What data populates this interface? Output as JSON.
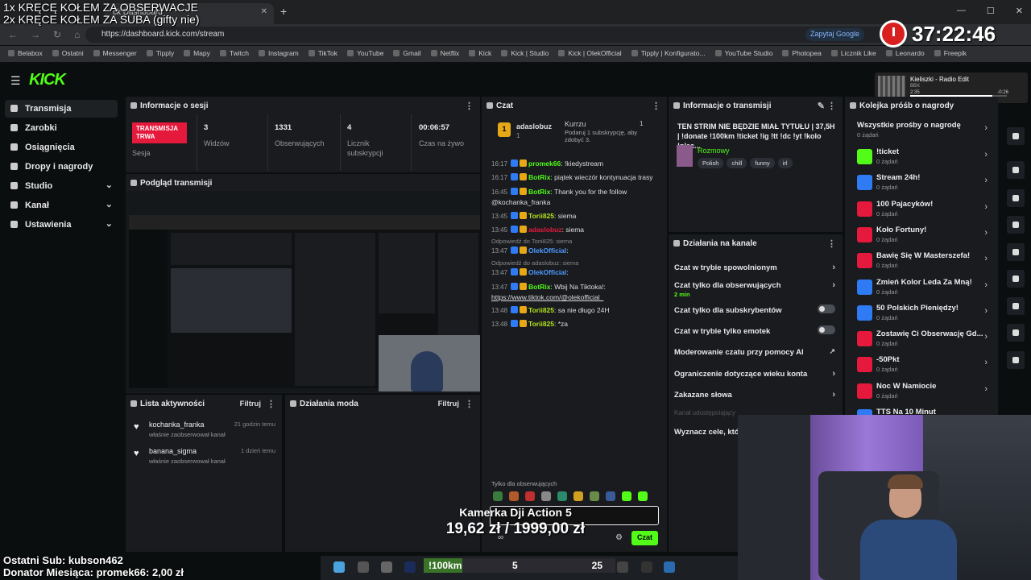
{
  "overlay": {
    "line1": "1x KRĘCĘ KOŁEM ZA OBSERWACJE",
    "line2": "2x KRĘCE KOŁEM ZA SUBA (gifty nie)",
    "timer": "37:22:46",
    "last_sub": "Ostatni Sub: kubson462",
    "donator": "Donator Miesiąca: promek66: 2,00 zł",
    "product_name": "Kamerka Dji Action 5",
    "product_price": "19,62 zł / 1999,00 zł"
  },
  "browser": {
    "tab_title": "ck Dashboard",
    "url": "https://dashboard.kick.com/stream",
    "ask_google": "Zapytaj Google",
    "bookmarks": [
      "Belabox",
      "Ostatni",
      "Messenger",
      "Tipply",
      "Mapy",
      "Twitch",
      "Instagram",
      "TikTok",
      "YouTube",
      "Gmail",
      "Netflix",
      "Kick",
      "Kick | Studio",
      "Kick | OlekOfficial",
      "Tipply | Konfigurato...",
      "YouTube Studio",
      "Photopea",
      "Licznik Like",
      "Leonardo",
      "Freepik"
    ]
  },
  "music": {
    "title": "Kieliszki - Radio Edit",
    "artist": "BBX",
    "elapsed": "2:35",
    "remaining": "-0:26",
    "progress": 0.85
  },
  "sidebar": {
    "items": [
      {
        "label": "Transmisja"
      },
      {
        "label": "Zarobki"
      },
      {
        "label": "Osiągnięcia"
      },
      {
        "label": "Dropy i nagrody"
      },
      {
        "label": "Studio"
      },
      {
        "label": "Kanał"
      },
      {
        "label": "Ustawienia"
      }
    ]
  },
  "session": {
    "title": "Informacje o sesji",
    "badge": "TRANSMISJA TRWA",
    "badge_label": "Sesja",
    "stats": [
      {
        "value": "3",
        "label": "Widzów"
      },
      {
        "value": "1331",
        "label": "Obserwujących"
      },
      {
        "value": "4",
        "label": "Licznik subskrypcji"
      },
      {
        "value": "00:06:57",
        "label": "Czas na żywo"
      }
    ]
  },
  "preview": {
    "title": "Podgląd transmisji"
  },
  "activity": {
    "title": "Lista aktywności",
    "filter": "Filtruj",
    "items": [
      {
        "name": "kochanka_franka",
        "desc": "właśnie zaobserwował kanał",
        "time": "21 godzin temu"
      },
      {
        "name": "banana_sigma",
        "desc": "właśnie zaobserwował kanał",
        "time": "1 dzień temu"
      }
    ]
  },
  "mod": {
    "title": "Działania moda",
    "filter": "Filtruj"
  },
  "chat": {
    "title": "Czat",
    "pinned": {
      "rank": "1",
      "user": "adaslobuz",
      "count": "1"
    },
    "pinned2": {
      "user": "Kurrzu",
      "count": "1",
      "text": "Podaruj 1 subskrypcję, aby zdobyć 3."
    },
    "messages": [
      {
        "time": "16:17",
        "user": "promek66",
        "text": "!kiedystream",
        "color": "#53fc18"
      },
      {
        "time": "16:17",
        "user": "BotRix",
        "text": "piątek wieczór kontynuacja trasy",
        "color": "#53fc18"
      },
      {
        "time": "16:45",
        "user": "BotRix",
        "text": "Thank you for the follow @kochanka_franka",
        "color": "#53fc18"
      },
      {
        "time": "13:45",
        "user": "Torii825",
        "text": "siema",
        "color": "#b5e61d"
      },
      {
        "time": "13:45",
        "user": "adaslobuz",
        "text": "siema",
        "color": "#e5193b"
      },
      {
        "time": "13:47",
        "user": "OlekOfficial",
        "text": "",
        "color": "#4e9bff",
        "reply": "Odpowiedź do Torii825: siema"
      },
      {
        "time": "13:47",
        "user": "OlekOfficial",
        "text": "",
        "color": "#4e9bff",
        "reply": "Odpowiedź do adaslobuz: siema"
      },
      {
        "time": "13:47",
        "user": "BotRix",
        "text": "Wbij Na Tiktoka!:",
        "color": "#53fc18",
        "link": "https://www.tiktok.com/@olekofficial_"
      },
      {
        "time": "13:48",
        "user": "Torii825",
        "text": "sa nie długo 24H",
        "color": "#b5e61d"
      },
      {
        "time": "13:48",
        "user": "Torii825",
        "text": "*za",
        "color": "#b5e61d"
      }
    ],
    "followers_only": "Tylko dla obserwujących",
    "send": "Czat"
  },
  "stream_info": {
    "title": "Informacje o transmisji",
    "stream_title": "TEN STRIM NIE BĘDZIE MIAŁ TYTUŁU | 37,5H | !donate !100km !ticket !ig !tt !dc !yt !kolo !plec...",
    "category": "Rozmowy",
    "tags": [
      "Polish",
      "chill",
      "funny",
      "irl"
    ]
  },
  "channel_actions": {
    "title": "Działania na kanale",
    "items": [
      {
        "label": "Czat w trybie spowolnionym",
        "type": "arrow"
      },
      {
        "label": "Czat tylko dla obserwujących",
        "sub": "2 min",
        "type": "arrow"
      },
      {
        "label": "Czat tylko dla subskrybentów",
        "type": "toggle"
      },
      {
        "label": "Czat w trybie tylko emotek",
        "type": "toggle"
      },
      {
        "label": "Moderowanie czatu przy pomocy AI",
        "type": "ext"
      },
      {
        "label": "Ograniczenie dotyczące wieku konta",
        "type": "arrow"
      },
      {
        "label": "Zakazane słowa",
        "type": "arrow"
      },
      {
        "label": "Kanał udostępniający",
        "type": "dim"
      },
      {
        "label": "Wyznacz cele, które",
        "type": "none"
      }
    ]
  },
  "rewards": {
    "title": "Kolejka próśb o nagrody",
    "all_label": "Wszystkie prośby o nagrodę",
    "all_count": "0 żądań",
    "items": [
      {
        "name": "!ticket",
        "count": "0 żądań",
        "color": "#53fc18"
      },
      {
        "name": "Stream 24h!",
        "count": "0 żądań",
        "color": "#2f7bf5"
      },
      {
        "name": "100 Pajacyków!",
        "count": "0 żądań",
        "color": "#e5193b"
      },
      {
        "name": "Koło Fortuny!",
        "count": "0 żądań",
        "color": "#e5193b"
      },
      {
        "name": "Bawię Się W Masterszefa!",
        "count": "0 żądań",
        "color": "#e5193b"
      },
      {
        "name": "Zmień Kolor Leda Za Mną!",
        "count": "0 żądań",
        "color": "#2f7bf5"
      },
      {
        "name": "50 Polskich Pieniędzy!",
        "count": "0 żądań",
        "color": "#2f7bf5"
      },
      {
        "name": "Zostawię Ci Obserwację Gd...",
        "count": "0 żądań",
        "color": "#e5193b"
      },
      {
        "name": "-50Pkt",
        "count": "0 żądań",
        "color": "#e5193b"
      },
      {
        "name": "Noc W Namiocie",
        "count": "0 żądań",
        "color": "#e5193b"
      },
      {
        "name": "TTS Na 10 Minut",
        "count": "",
        "color": "#2f7bf5"
      }
    ]
  },
  "km": {
    "label": "!100km",
    "current": "5",
    "max": "25",
    "progress": 0.2
  }
}
